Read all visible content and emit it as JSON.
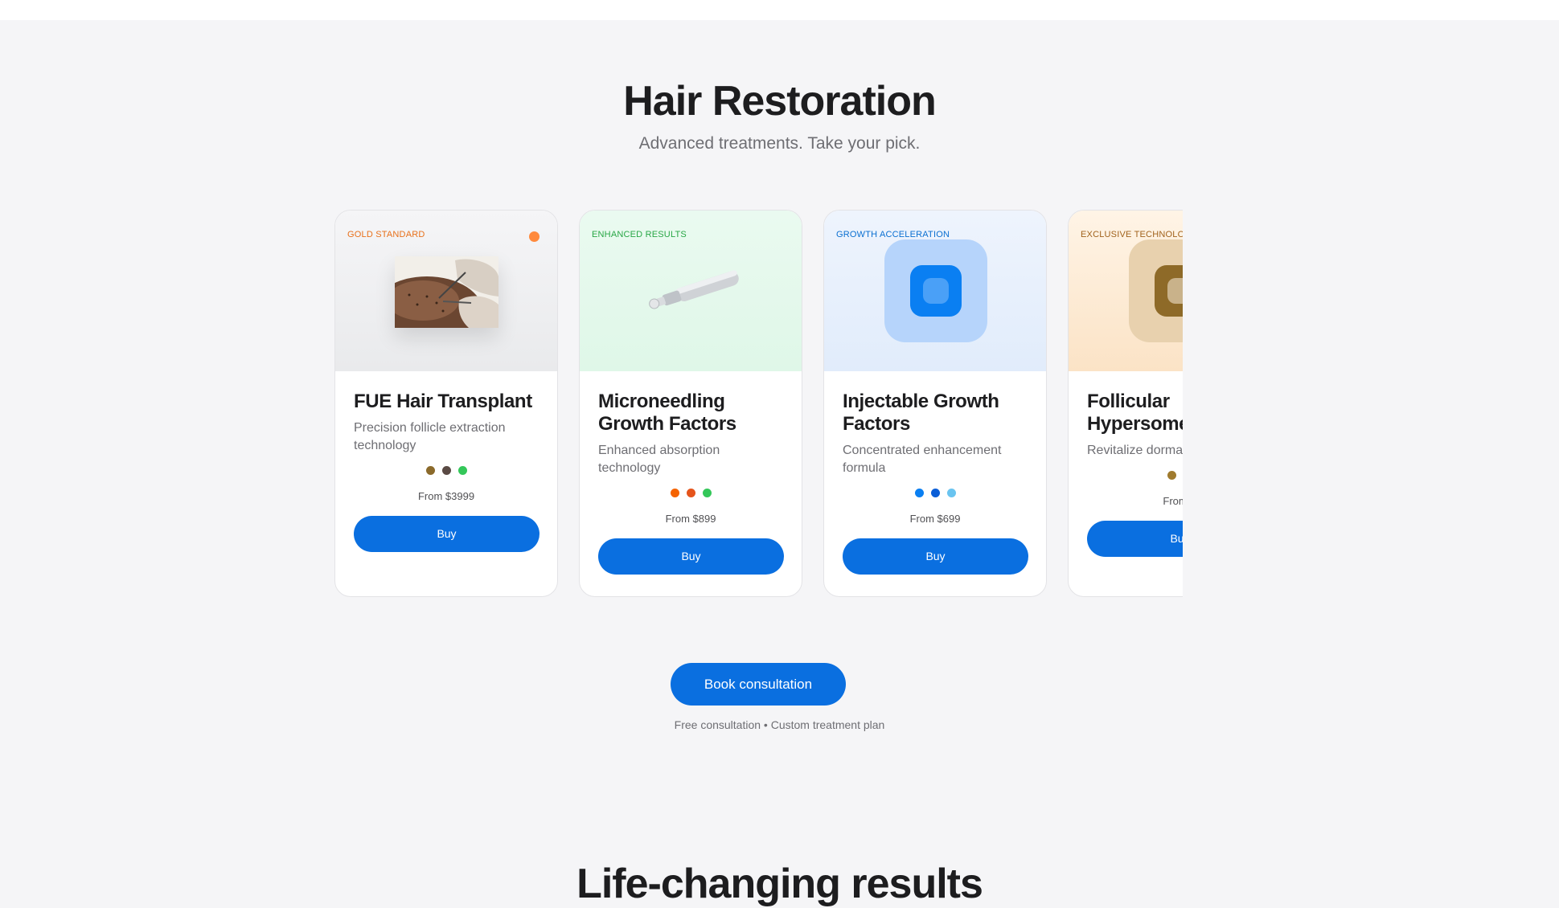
{
  "section": {
    "title": "Hair Restoration",
    "subtitle": "Advanced treatments. Take your pick."
  },
  "cards": [
    {
      "tag": "GOLD STANDARD",
      "tag_color": "#e8701a",
      "media_bg": "#eeeff1",
      "name": "FUE Hair Transplant",
      "description": "Precision follicle extraction technology",
      "swatches": [
        "#8b6a2b",
        "#5a4a44",
        "#34c759"
      ],
      "price": "From $3999",
      "button": "Buy",
      "image": "procedure-photo"
    },
    {
      "tag": "ENHANCED RESULTS",
      "tag_color": "#28a745",
      "media_bg": "#e3f8ea",
      "name": "Microneedling Growth Factors",
      "description": "Enhanced absorption technology",
      "swatches": [
        "#f56300",
        "#e5541b",
        "#34c759"
      ],
      "price": "From $899",
      "button": "Buy",
      "image": "microneedling-pen"
    },
    {
      "tag": "GROWTH ACCELERATION",
      "tag_color": "#0a6fd1",
      "media_bg": "#e6effc",
      "name": "Injectable Growth Factors",
      "description": "Concentrated enhancement formula",
      "swatches": [
        "#0a7ff2",
        "#0a5ed7",
        "#6ac4f0"
      ],
      "price": "From $699",
      "button": "Buy",
      "image": "app-icon-blue"
    },
    {
      "tag": "EXCLUSIVE TECHNOLOGY",
      "tag_color": "#a0621c",
      "media_bg": "#fbe9d3",
      "name": "Follicular Hypersome",
      "description": "Revitalize dormant",
      "swatches": [
        "#a07b2e",
        "#5a4a44"
      ],
      "price": "From $",
      "button": "Buy",
      "image": "app-icon-gold"
    }
  ],
  "cta": {
    "button": "Book consultation",
    "note": "Free consultation • Custom treatment plan"
  },
  "next_section": {
    "title": "Life-changing results"
  }
}
